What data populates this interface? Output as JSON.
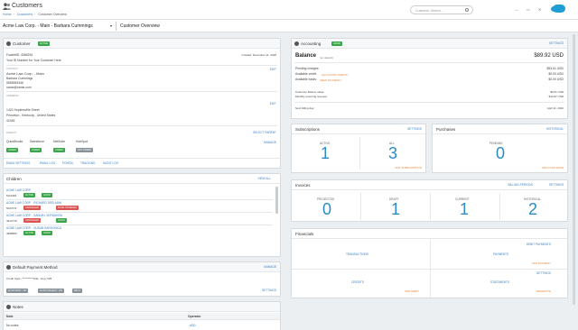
{
  "app": {
    "title": "Customers",
    "breadcrumb": [
      "Home",
      "Customers",
      "Customer Overview"
    ],
    "search_placeholder": "Customer Search..."
  },
  "context": {
    "account": "Acme Law Corp. - Main - Barbara Cummings",
    "title": "Customer Overview"
  },
  "customer": {
    "title": "Customer",
    "status": "ACTIVE",
    "fusebill_id": "FusebillD: 4066254",
    "your_id": "Your ID Number for Your Customer Here",
    "created": "Created: December 11, 2018",
    "contact_label": "CONTACT",
    "edit": "EDIT",
    "company": "Acme Law Corp. - Main",
    "name": "Barbara Cummings",
    "phone": "5555555346",
    "email": "name@name.com",
    "address_label": "ADDRESS",
    "street": "1421 Hopkinsville Street",
    "city": "Princeton , Kentucky , United States",
    "zip": "42445",
    "parent_label": "PARENT",
    "select_parent": "SELECT PARENT",
    "manage": "MANAGE",
    "integrations": [
      {
        "name": "QuickBooks",
        "status": "LINKED"
      },
      {
        "name": "Salesforce",
        "status": "LINKED"
      },
      {
        "name": "NetSuite",
        "status": "LINKED"
      },
      {
        "name": "HubSpot",
        "status": "NOT LINKED"
      }
    ],
    "footer_links": [
      "EMAIL SETTINGS",
      "EMAIL LOG",
      "PORTAL",
      "TRACKING",
      "AUDIT LOG"
    ]
  },
  "children": {
    "title": "Children",
    "view_all": "VIEW ALL",
    "items": [
      {
        "name": "ACME LAW CORP.",
        "id": "5114381",
        "badges": [
          {
            "t": "ACTIVE",
            "c": "green"
          },
          {
            "t": "GOOD",
            "c": "green"
          }
        ]
      },
      {
        "name": "ACME LAW CORP. - RICHARD DEELMAN",
        "id": "5027071",
        "badges": [
          {
            "t": "CANCELLED",
            "c": "red"
          },
          {
            "t": "POOR STANDING",
            "c": "red"
          }
        ]
      },
      {
        "name": "ACME LAW CORP. - SAMUEL VERDUKRA",
        "id": "4912719",
        "badges": [
          {
            "t": "CANCELLED",
            "c": "red"
          },
          {
            "t": "GOOD",
            "c": "green"
          }
        ]
      },
      {
        "name": "ACME LAW CORP. - SUSAN SARDONICA",
        "id": "4958893",
        "badges": [
          {
            "t": "ACTIVE",
            "c": "green"
          },
          {
            "t": "GOOD",
            "c": "green"
          }
        ]
      }
    ]
  },
  "payment": {
    "title": "Default Payment Method",
    "manage": "MANAGE",
    "card": "Credit Card - **********1111 - Exp 7/25",
    "tags": [
      "AUTO POST - ON",
      "AUTO COLLECT - ON",
      "NET 0"
    ],
    "settings": "SETTINGS"
  },
  "notes": {
    "title": "Notes",
    "col_note": "Note",
    "col_operator": "Operator",
    "row_note": "No notes",
    "row_action": "ADD"
  },
  "accounting": {
    "title": "Accounting",
    "status": "GOOD",
    "settings": "SETTINGS",
    "balance_label": "Balance",
    "balance_sub": "(on deposit)",
    "balance": "$89.92 USD",
    "rows": [
      {
        "l": "Pending charges:",
        "v": "$53.61 USD"
      },
      {
        "l": "Available credit:",
        "link": "(ALLOCATE CREDIT)",
        "v": "$0.00 USD"
      },
      {
        "l": "Available funds:",
        "link": "(NEW PAYMENT)",
        "v": "$0.00 USD"
      }
    ],
    "lifetime_label": "Customer lifetime value:",
    "lifetime": "$0.61 USD",
    "mrr_label": "Monthly recurring revenue:",
    "mrr": "$10.97 USD",
    "next_label": "Next billing day:",
    "next": "April 11, 2022"
  },
  "subscriptions": {
    "title": "Subscriptions",
    "settings": "SETTINGS",
    "active_label": "ACTIVE",
    "active": "1",
    "all_label": "ALL",
    "all": "3",
    "add": "ADD SUBSCRIPTION"
  },
  "purchases": {
    "title": "Purchases",
    "historical": "HISTORICAL",
    "pending_label": "PENDING",
    "pending": "0",
    "add": "ADD PURCHASE"
  },
  "invoices": {
    "title": "Invoices",
    "billing_periods": "BILLING PERIODS",
    "settings": "SETTINGS",
    "tiles": [
      {
        "l": "PROJECTED",
        "v": "0"
      },
      {
        "l": "DRAFT",
        "v": "1"
      },
      {
        "l": "CURRENT",
        "v": "1"
      },
      {
        "l": "HISTORICAL",
        "v": "2"
      }
    ]
  },
  "financials": {
    "title": "Financials",
    "transactions": "TRANSACTIONS",
    "payments": "PAYMENTS",
    "debit_payments": "DEBIT PAYMENTS",
    "add_payment": "ADD PAYMENT",
    "credits": "CREDITS",
    "add_debit": "ADD DEBIT",
    "statements": "STATEMENTS",
    "settings": "SETTINGS",
    "generate": "GENERATE"
  }
}
